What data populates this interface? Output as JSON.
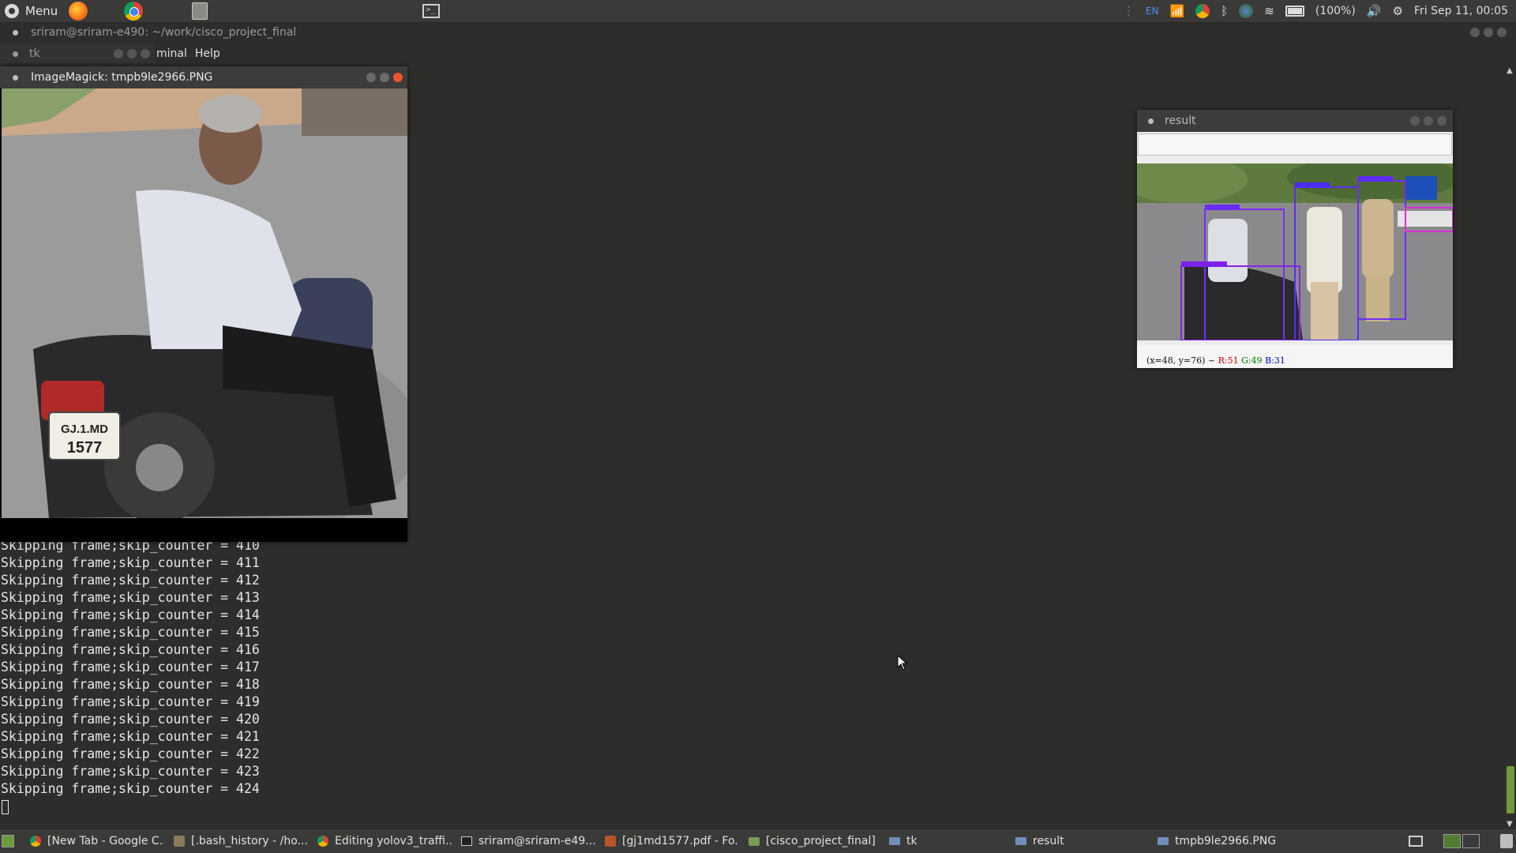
{
  "top_panel": {
    "menu_label": "Menu",
    "launchers": [
      "firefox-icon",
      "chrome-icon",
      "files-icon",
      "terminal-icon"
    ],
    "tray": {
      "language": "EN",
      "battery": "(100%)",
      "clock": "Fri Sep 11, 00:05"
    }
  },
  "terminal": {
    "title": "sriram@sriram-e490: ~/work/cisco_project_final",
    "tab_label": "tk",
    "menu": [
      "minal",
      "Help"
    ],
    "lines": [
      "Skipping frame;skip_counter = 410",
      "Skipping frame;skip_counter = 411",
      "Skipping frame;skip_counter = 412",
      "Skipping frame;skip_counter = 413",
      "Skipping frame;skip_counter = 414",
      "Skipping frame;skip_counter = 415",
      "Skipping frame;skip_counter = 416",
      "Skipping frame;skip_counter = 417",
      "Skipping frame;skip_counter = 418",
      "Skipping frame;skip_counter = 419",
      "Skipping frame;skip_counter = 420",
      "Skipping frame;skip_counter = 421",
      "Skipping frame;skip_counter = 422",
      "Skipping frame;skip_counter = 423",
      "Skipping frame;skip_counter = 424"
    ]
  },
  "imagemagick_window": {
    "title": "ImageMagick: tmpb9le2966.PNG",
    "plate_line1": "GJ.1.MD",
    "plate_line2": "1577"
  },
  "result_window": {
    "title": "result",
    "status_prefix": "(x=48, y=76) ~",
    "status_r": "R:51",
    "status_g": "G:49",
    "status_b": "B:31"
  },
  "taskbar": {
    "items": [
      {
        "label": "[New Tab - Google C...",
        "icon": "chrome-icon"
      },
      {
        "label": "[.bash_history - /ho...",
        "icon": "gedit-icon"
      },
      {
        "label": "Editing yolov3_traffi...",
        "icon": "chrome-icon"
      },
      {
        "label": "sriram@sriram-e49...",
        "icon": "terminal-icon"
      },
      {
        "label": "[gj1md1577.pdf - Fo...",
        "icon": "pdf-icon"
      },
      {
        "label": "[cisco_project_final]",
        "icon": "folder-icon"
      },
      {
        "label": "tk",
        "icon": "window-icon"
      },
      {
        "label": "result",
        "icon": "window-icon"
      },
      {
        "label": "tmpb9le2966.PNG",
        "icon": "window-icon"
      }
    ]
  }
}
